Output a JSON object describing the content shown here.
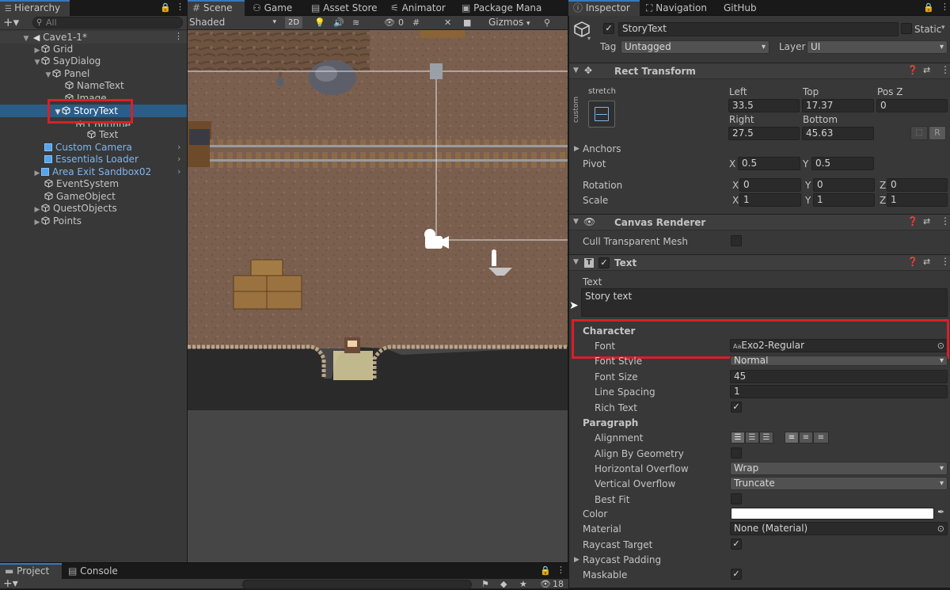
{
  "hierarchy": {
    "tab_label": "Hierarchy",
    "search_placeholder": "All",
    "scene_name": "Cave1-1*",
    "items": [
      {
        "label": "Grid"
      },
      {
        "label": "SayDialog"
      },
      {
        "label": "Panel"
      },
      {
        "label": "NameText"
      },
      {
        "label": "Image"
      },
      {
        "label": "StoryText"
      },
      {
        "label": "Continue"
      },
      {
        "label": "Text"
      },
      {
        "label": "Custom Camera"
      },
      {
        "label": "Essentials Loader"
      },
      {
        "label": "Area Exit Sandbox02"
      },
      {
        "label": "EventSystem"
      },
      {
        "label": "GameObject"
      },
      {
        "label": "QuestObjects"
      },
      {
        "label": "Points"
      }
    ]
  },
  "scene_tabs": [
    "Scene",
    "Game",
    "Asset Store",
    "Animator",
    "Package Mana"
  ],
  "scene_toolbar": {
    "shading": "Shaded",
    "mode_2d": "2D",
    "hidden_count": "0",
    "gizmos": "Gizmos"
  },
  "bottom": {
    "project_tab": "Project",
    "console_tab": "Console",
    "count": "18"
  },
  "inspector": {
    "tabs": [
      "Inspector",
      "Navigation",
      "GitHub"
    ],
    "object_name": "StoryText",
    "static_label": "Static",
    "tag_label": "Tag",
    "tag_value": "Untagged",
    "layer_label": "Layer",
    "layer_value": "UI",
    "rect": {
      "title": "Rect Transform",
      "stretch": "stretch",
      "custom": "custom",
      "col1_top": "Left",
      "col2_top": "Top",
      "col3_top": "Pos Z",
      "left": "33.5",
      "top": "17.37",
      "posz": "0",
      "col1_bottom": "Right",
      "col2_bottom": "Bottom",
      "right": "27.5",
      "bottom": "45.63",
      "r_button": "R",
      "anchors": "Anchors",
      "pivot_label": "Pivot",
      "pivot_x": "0.5",
      "pivot_y": "0.5",
      "rotation_label": "Rotation",
      "rot_x": "0",
      "rot_y": "0",
      "rot_z": "0",
      "scale_label": "Scale",
      "scale_x": "1",
      "scale_y": "1",
      "scale_z": "1",
      "x": "X",
      "y": "Y",
      "z": "Z"
    },
    "canvas_renderer": {
      "title": "Canvas Renderer",
      "cull_label": "Cull Transparent Mesh"
    },
    "text": {
      "title": "Text",
      "text_label": "Text",
      "text_value": "Story text",
      "character": "Character",
      "font_label": "Font",
      "font_value": "Exo2-Regular",
      "font_prefix": "Aa",
      "font_style_label": "Font Style",
      "font_style_value": "Normal",
      "font_size_label": "Font Size",
      "font_size_value": "45",
      "line_spacing_label": "Line Spacing",
      "line_spacing_value": "1",
      "rich_text_label": "Rich Text",
      "paragraph": "Paragraph",
      "alignment_label": "Alignment",
      "align_geometry_label": "Align By Geometry",
      "h_overflow_label": "Horizontal Overflow",
      "h_overflow_value": "Wrap",
      "v_overflow_label": "Vertical Overflow",
      "v_overflow_value": "Truncate",
      "best_fit_label": "Best Fit",
      "color_label": "Color",
      "color_value": "#ffffff",
      "material_label": "Material",
      "material_value": "None (Material)",
      "raycast_target_label": "Raycast Target",
      "raycast_padding_label": "Raycast Padding",
      "maskable_label": "Maskable"
    }
  }
}
